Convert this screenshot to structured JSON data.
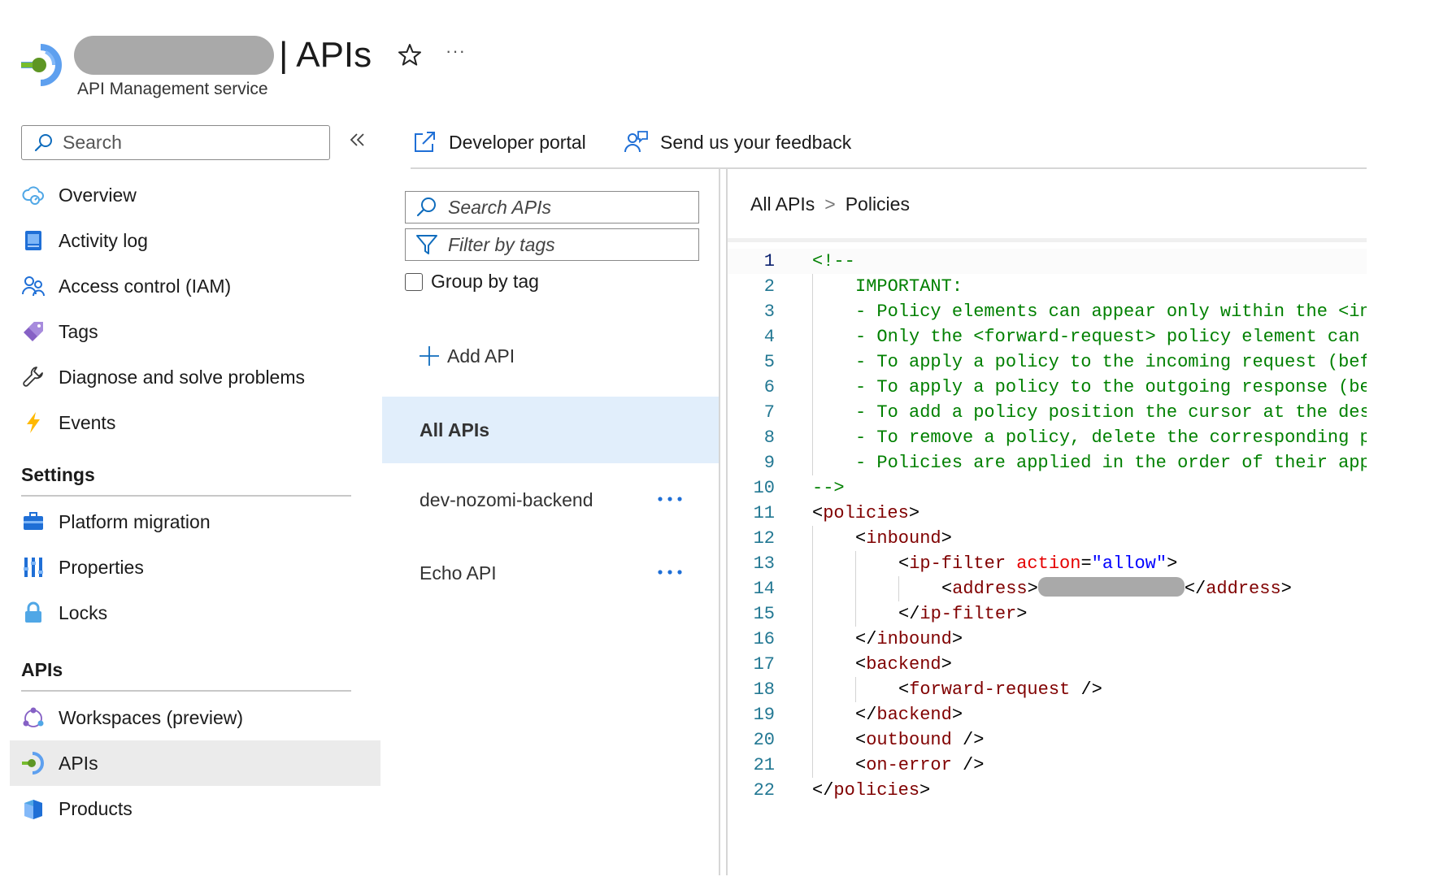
{
  "header": {
    "title": "| APIs",
    "subtitle": "API Management service",
    "more_label": "···"
  },
  "nav": {
    "search_placeholder": "Search",
    "items_top": [
      {
        "label": "Overview",
        "icon": "cloud-icon"
      },
      {
        "label": "Activity log",
        "icon": "activity-log-icon"
      },
      {
        "label": "Access control (IAM)",
        "icon": "people-icon"
      },
      {
        "label": "Tags",
        "icon": "tag-icon"
      },
      {
        "label": "Diagnose and solve problems",
        "icon": "wrench-icon"
      },
      {
        "label": "Events",
        "icon": "lightning-icon"
      }
    ],
    "settings_heading": "Settings",
    "settings_items": [
      {
        "label": "Platform migration",
        "icon": "briefcase-icon"
      },
      {
        "label": "Properties",
        "icon": "properties-icon"
      },
      {
        "label": "Locks",
        "icon": "lock-icon"
      }
    ],
    "apis_heading": "APIs",
    "apis_items": [
      {
        "label": "Workspaces (preview)",
        "icon": "workspaces-icon"
      },
      {
        "label": "APIs",
        "icon": "api-icon",
        "selected": true
      },
      {
        "label": "Products",
        "icon": "products-icon"
      }
    ]
  },
  "commands": {
    "developer_portal": "Developer portal",
    "feedback": "Send us your feedback"
  },
  "api_list": {
    "search_placeholder": "Search APIs",
    "filter_placeholder": "Filter by tags",
    "group_by_label": "Group by tag",
    "add_label": "Add API",
    "rows": [
      {
        "name": "All APIs",
        "selected": true
      },
      {
        "name": "dev-nozomi-backend"
      },
      {
        "name": "Echo API"
      }
    ]
  },
  "breadcrumb": {
    "root": "All APIs",
    "separator": ">",
    "current": "Policies"
  },
  "editor": {
    "current_line": 1,
    "lines": [
      {
        "n": "1",
        "indent": 0,
        "tokens": [
          {
            "c": "cm",
            "t": "<!--"
          }
        ]
      },
      {
        "n": "2",
        "indent": 1,
        "tokens": [
          {
            "c": "cm",
            "t": "IMPORTANT:"
          }
        ]
      },
      {
        "n": "3",
        "indent": 1,
        "tokens": [
          {
            "c": "cm",
            "t": "- Policy elements can appear only within the <in"
          }
        ]
      },
      {
        "n": "4",
        "indent": 1,
        "tokens": [
          {
            "c": "cm",
            "t": "- Only the <forward-request> policy element can "
          }
        ]
      },
      {
        "n": "5",
        "indent": 1,
        "tokens": [
          {
            "c": "cm",
            "t": "- To apply a policy to the incoming request (bef"
          }
        ]
      },
      {
        "n": "6",
        "indent": 1,
        "tokens": [
          {
            "c": "cm",
            "t": "- To apply a policy to the outgoing response (be"
          }
        ]
      },
      {
        "n": "7",
        "indent": 1,
        "tokens": [
          {
            "c": "cm",
            "t": "- To add a policy position the cursor at the des"
          }
        ]
      },
      {
        "n": "8",
        "indent": 1,
        "tokens": [
          {
            "c": "cm",
            "t": "- To remove a policy, delete the corresponding p"
          }
        ]
      },
      {
        "n": "9",
        "indent": 1,
        "tokens": [
          {
            "c": "cm",
            "t": "- Policies are applied in the order of their app"
          }
        ]
      },
      {
        "n": "10",
        "indent": 0,
        "tokens": [
          {
            "c": "cm",
            "t": "-->"
          }
        ]
      },
      {
        "n": "11",
        "indent": 0,
        "tokens": [
          {
            "c": "p",
            "t": "<"
          },
          {
            "c": "tag",
            "t": "policies"
          },
          {
            "c": "p",
            "t": ">"
          }
        ]
      },
      {
        "n": "12",
        "indent": 1,
        "tokens": [
          {
            "c": "p",
            "t": "<"
          },
          {
            "c": "tag",
            "t": "inbound"
          },
          {
            "c": "p",
            "t": ">"
          }
        ]
      },
      {
        "n": "13",
        "indent": 2,
        "tokens": [
          {
            "c": "p",
            "t": "<"
          },
          {
            "c": "tag",
            "t": "ip-filter"
          },
          {
            "c": "p",
            "t": " "
          },
          {
            "c": "attr",
            "t": "action"
          },
          {
            "c": "p",
            "t": "="
          },
          {
            "c": "val",
            "t": "\"allow\""
          },
          {
            "c": "p",
            "t": ">"
          }
        ]
      },
      {
        "n": "14",
        "indent": 3,
        "tokens": [
          {
            "c": "p",
            "t": "<"
          },
          {
            "c": "tag",
            "t": "address"
          },
          {
            "c": "p",
            "t": ">"
          },
          {
            "c": "redact",
            "t": ""
          },
          {
            "c": "p",
            "t": "</"
          },
          {
            "c": "tag",
            "t": "address"
          },
          {
            "c": "p",
            "t": ">"
          }
        ]
      },
      {
        "n": "15",
        "indent": 2,
        "tokens": [
          {
            "c": "p",
            "t": "</"
          },
          {
            "c": "tag",
            "t": "ip-filter"
          },
          {
            "c": "p",
            "t": ">"
          }
        ]
      },
      {
        "n": "16",
        "indent": 1,
        "tokens": [
          {
            "c": "p",
            "t": "</"
          },
          {
            "c": "tag",
            "t": "inbound"
          },
          {
            "c": "p",
            "t": ">"
          }
        ]
      },
      {
        "n": "17",
        "indent": 1,
        "tokens": [
          {
            "c": "p",
            "t": "<"
          },
          {
            "c": "tag",
            "t": "backend"
          },
          {
            "c": "p",
            "t": ">"
          }
        ]
      },
      {
        "n": "18",
        "indent": 2,
        "tokens": [
          {
            "c": "p",
            "t": "<"
          },
          {
            "c": "tag",
            "t": "forward-request"
          },
          {
            "c": "p",
            "t": " />"
          }
        ]
      },
      {
        "n": "19",
        "indent": 1,
        "tokens": [
          {
            "c": "p",
            "t": "</"
          },
          {
            "c": "tag",
            "t": "backend"
          },
          {
            "c": "p",
            "t": ">"
          }
        ]
      },
      {
        "n": "20",
        "indent": 1,
        "tokens": [
          {
            "c": "p",
            "t": "<"
          },
          {
            "c": "tag",
            "t": "outbound"
          },
          {
            "c": "p",
            "t": " />"
          }
        ]
      },
      {
        "n": "21",
        "indent": 1,
        "tokens": [
          {
            "c": "p",
            "t": "<"
          },
          {
            "c": "tag",
            "t": "on-error"
          },
          {
            "c": "p",
            "t": " />"
          }
        ]
      },
      {
        "n": "22",
        "indent": 0,
        "tokens": [
          {
            "c": "p",
            "t": "</"
          },
          {
            "c": "tag",
            "t": "policies"
          },
          {
            "c": "p",
            "t": ">"
          }
        ]
      }
    ]
  }
}
